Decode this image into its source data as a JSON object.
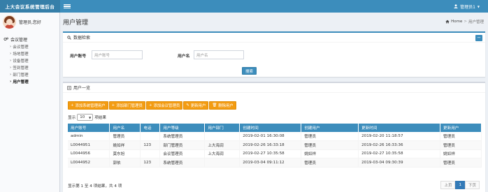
{
  "app": {
    "brand": "上大会议系统管理后台",
    "user_name": "管理员1"
  },
  "sidebar": {
    "greeting": "管理员,您好",
    "section_label": "会议管理",
    "items": [
      {
        "label": "会议管理"
      },
      {
        "label": "场地管理"
      },
      {
        "label": "设备管理"
      },
      {
        "label": "签到管理"
      },
      {
        "label": "部门管理"
      },
      {
        "label": "用户管理"
      }
    ]
  },
  "header": {
    "title": "用户管理",
    "breadcrumb_home": "Home",
    "breadcrumb_current": "用户管理"
  },
  "search_box": {
    "title": "数据检索",
    "account_label": "用户账号",
    "account_placeholder": "用户账号",
    "name_label": "用户名",
    "name_placeholder": "用户名",
    "search_button": "搜索",
    "collapse": "−"
  },
  "list_box": {
    "title": "用户一览",
    "buttons": [
      {
        "label": "添加系统管理用户"
      },
      {
        "label": "添加部门管理员"
      },
      {
        "label": "添加会议管理员"
      },
      {
        "label": "更新用户"
      },
      {
        "label": "删除用户"
      }
    ],
    "show_label": "显示",
    "page_size": "10",
    "entries_label": "项结果",
    "columns": [
      "用户账号",
      "用户名",
      "电话",
      "用户等级",
      "用户部门",
      "创建时间",
      "创建用户",
      "更新时间",
      "更新用户"
    ],
    "rows": [
      [
        "admin",
        "管理员",
        "",
        "系统管理员",
        "",
        "2019-02-01 16:30:08",
        "管理员",
        "2019-02-20 11:18:57",
        "管理员"
      ],
      [
        "L0044951",
        "姚如祥",
        "123",
        "部门管理员",
        "上大海润",
        "2019-02-26 16:33:18",
        "管理员",
        "2019-02-26 16:33:36",
        "管理员"
      ],
      [
        "L0044956",
        "莫东旭",
        "",
        "会议管理员",
        "上大海润",
        "2019-02-27 10:35:58",
        "姚如祥",
        "2019-02-27 10:35:58",
        "姚如祥"
      ],
      [
        "L0044952",
        "郭依",
        "123",
        "系统管理员",
        "",
        "2019-03-04 09:11:12",
        "管理员",
        "2019-03-04 09:30:39",
        "管理员"
      ]
    ],
    "info": "显示第 1 至 4 项结果，共 4 项",
    "pager": {
      "prev": "上页",
      "current": "1",
      "next": "下页"
    }
  }
}
